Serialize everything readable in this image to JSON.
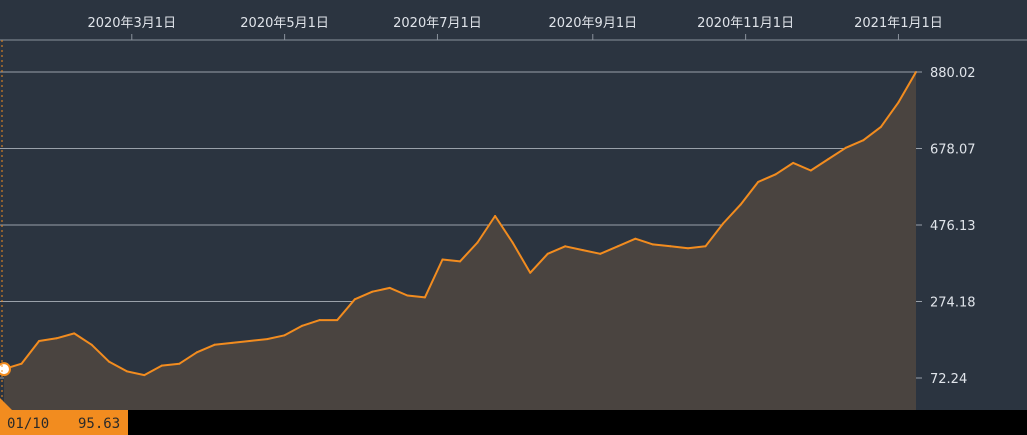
{
  "chart_data": {
    "type": "area",
    "x_ticks": [
      "2020年3月1日",
      "2020年5月1日",
      "2020年7月1日",
      "2020年9月1日",
      "2020年11月1日",
      "2021年1月1日"
    ],
    "y_ticks": [
      "880.02",
      "678.07",
      "476.13",
      "274.18",
      "72.24"
    ],
    "y_tick_values": [
      880.02,
      678.07,
      476.13,
      274.18,
      72.24
    ],
    "ylim": [
      20,
      950
    ],
    "x": [
      "2020-01-10",
      "2020-01-17",
      "2020-01-24",
      "2020-01-31",
      "2020-02-07",
      "2020-02-14",
      "2020-02-21",
      "2020-02-28",
      "2020-03-06",
      "2020-03-13",
      "2020-03-20",
      "2020-03-27",
      "2020-04-03",
      "2020-04-10",
      "2020-04-17",
      "2020-04-24",
      "2020-05-01",
      "2020-05-08",
      "2020-05-15",
      "2020-05-22",
      "2020-05-29",
      "2020-06-05",
      "2020-06-12",
      "2020-06-19",
      "2020-06-26",
      "2020-07-03",
      "2020-07-10",
      "2020-07-17",
      "2020-07-24",
      "2020-07-31",
      "2020-08-07",
      "2020-08-14",
      "2020-08-21",
      "2020-08-28",
      "2020-09-04",
      "2020-09-11",
      "2020-09-18",
      "2020-09-25",
      "2020-10-02",
      "2020-10-09",
      "2020-10-16",
      "2020-10-23",
      "2020-10-30",
      "2020-11-06",
      "2020-11-13",
      "2020-11-20",
      "2020-11-27",
      "2020-12-04",
      "2020-12-11",
      "2020-12-18",
      "2020-12-25",
      "2021-01-01",
      "2021-01-08"
    ],
    "values": [
      95.63,
      110,
      170,
      177,
      190,
      160,
      115,
      90,
      80,
      105,
      110,
      140,
      160,
      165,
      170,
      175,
      185,
      210,
      225,
      225,
      280,
      300,
      310,
      290,
      285,
      385,
      380,
      430,
      500,
      430,
      350,
      400,
      420,
      410,
      400,
      420,
      440,
      425,
      420,
      415,
      420,
      480,
      530,
      590,
      610,
      640,
      620,
      650,
      680,
      700,
      735,
      800,
      880.02
    ],
    "series_color": "#f28c1f",
    "fill_color": "#4a4440",
    "grid": true,
    "crosshair": {
      "date": "01/10",
      "value": "95.63"
    }
  }
}
